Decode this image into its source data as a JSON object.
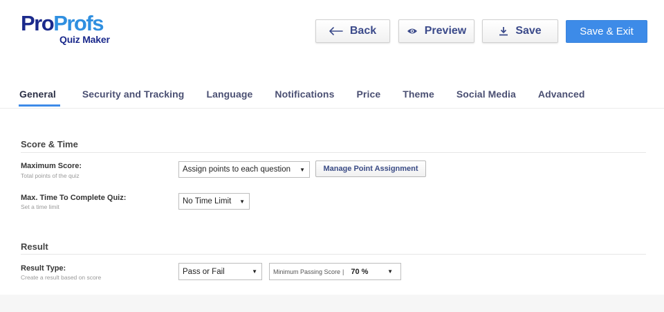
{
  "logo": {
    "part1": "Pro",
    "part2": "Profs",
    "subtitle": "Quiz Maker"
  },
  "header": {
    "back_label": "Back",
    "preview_label": "Preview",
    "save_label": "Save",
    "save_exit_label": "Save & Exit"
  },
  "tabs": [
    {
      "label": "General",
      "active": true
    },
    {
      "label": "Security and Tracking",
      "active": false
    },
    {
      "label": "Language",
      "active": false
    },
    {
      "label": "Notifications",
      "active": false
    },
    {
      "label": "Price",
      "active": false
    },
    {
      "label": "Theme",
      "active": false
    },
    {
      "label": "Social Media",
      "active": false
    },
    {
      "label": "Advanced",
      "active": false
    }
  ],
  "score_time": {
    "title": "Score & Time",
    "max_score": {
      "label": "Maximum Score:",
      "sub": "Total points of the quiz",
      "selected": "Assign points to each question",
      "manage_button": "Manage Point Assignment"
    },
    "max_time": {
      "label": "Max. Time To Complete Quiz:",
      "sub": "Set a time limit",
      "selected": "No Time Limit"
    }
  },
  "result": {
    "title": "Result",
    "result_type": {
      "label": "Result Type:",
      "sub": "Create a result based on score",
      "selected": "Pass or Fail",
      "passing_label": "Minimum Passing Score",
      "passing_separator": "|",
      "passing_value": "70 %"
    }
  },
  "colors": {
    "accent": "#3d8be8",
    "brand_dark": "#1b2a8c",
    "brand_light": "#2f8fe0"
  },
  "icons": {
    "back": "arrow-left-icon",
    "preview": "eye-icon",
    "save": "download-icon",
    "caret": "caret-down-icon"
  }
}
